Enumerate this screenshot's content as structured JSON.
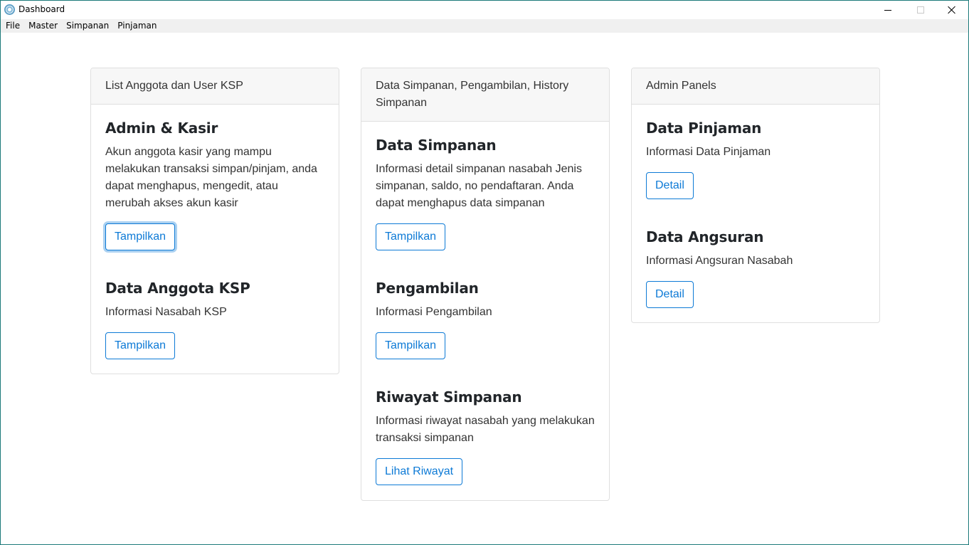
{
  "window": {
    "title": "Dashboard"
  },
  "menu": {
    "items": [
      "File",
      "Master",
      "Simpanan",
      "Pinjaman"
    ]
  },
  "cards": [
    {
      "header": "List Anggota dan User KSP",
      "sections": [
        {
          "title": "Admin & Kasir",
          "text": "Akun anggota kasir yang mampu melakukan transaksi simpan/pinjam, anda dapat menghapus, mengedit, atau merubah akses akun kasir",
          "button": "Tampilkan"
        },
        {
          "title": "Data Anggota KSP",
          "text": "Informasi Nasabah KSP",
          "button": "Tampilkan"
        }
      ]
    },
    {
      "header": "Data Simpanan, Pengambilan, History Simpanan",
      "sections": [
        {
          "title": "Data Simpanan",
          "text": "Informasi detail simpanan nasabah Jenis simpanan, saldo, no pendaftaran. Anda dapat menghapus data simpanan",
          "button": "Tampilkan"
        },
        {
          "title": "Pengambilan",
          "text": "Informasi Pengambilan",
          "button": "Tampilkan"
        },
        {
          "title": "Riwayat Simpanan",
          "text": "Informasi riwayat nasabah yang melakukan transaksi simpanan",
          "button": "Lihat Riwayat"
        }
      ]
    },
    {
      "header": "Admin Panels",
      "sections": [
        {
          "title": "Data Pinjaman",
          "text": "Informasi Data Pinjaman",
          "button": "Detail"
        },
        {
          "title": "Data Angsuran",
          "text": "Informasi Angsuran Nasabah",
          "button": "Detail"
        }
      ]
    }
  ],
  "colors": {
    "accent": "#0d7ad6",
    "card_header_bg": "#f7f7f7",
    "menubar_bg": "#f0f0f0",
    "window_border": "#1c7a7a"
  }
}
